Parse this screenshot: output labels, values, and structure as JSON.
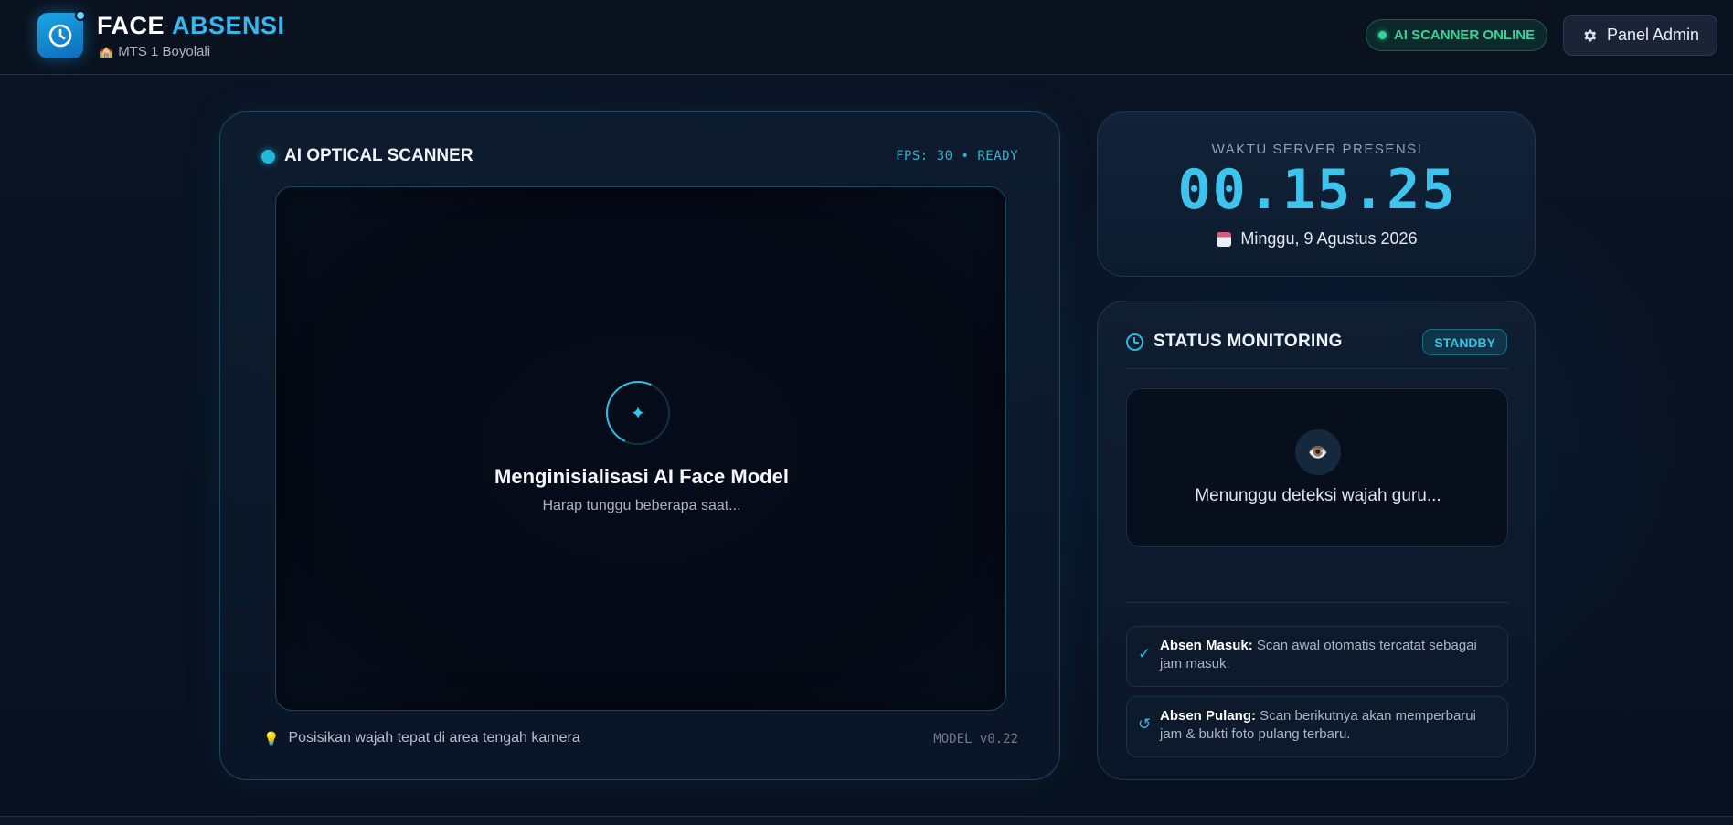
{
  "header": {
    "brand_first": "FACE",
    "brand_second": "ABSENSI",
    "school_icon": "🏫",
    "school": "MTS 1 Boyolali",
    "scanner_status": "AI SCANNER ONLINE",
    "admin_label": "Panel Admin"
  },
  "scanner": {
    "title": "AI OPTICAL SCANNER",
    "fps": "FPS: 30 • READY",
    "loading_title": "Menginisialisasi AI Face Model",
    "loading_sub": "Harap tunggu beberapa saat...",
    "tip_icon": "💡",
    "tip": "Posisikan wajah tepat di area tengah kamera",
    "model_version": "MODEL v0.22"
  },
  "clock": {
    "label": "WAKTU SERVER PRESENSI",
    "time": "00.15.25",
    "date": "Minggu, 9 Agustus 2026"
  },
  "status": {
    "title": "STATUS MONITORING",
    "badge": "STANDBY",
    "eye_icon": "👁️",
    "detect_text": "Menunggu deteksi wajah guru...",
    "masuk_icon": "✓",
    "masuk_title": "Absen Masuk:",
    "masuk_desc": " Scan awal otomatis tercatat sebagai jam masuk.",
    "pulang_icon": "↺",
    "pulang_title": "Absen Pulang:",
    "pulang_desc": " Scan berikutnya akan memperbarui jam & bukti foto pulang terbaru."
  },
  "colors": {
    "accent": "#38b6ee",
    "online": "#34d399",
    "background": "#0a1120"
  }
}
